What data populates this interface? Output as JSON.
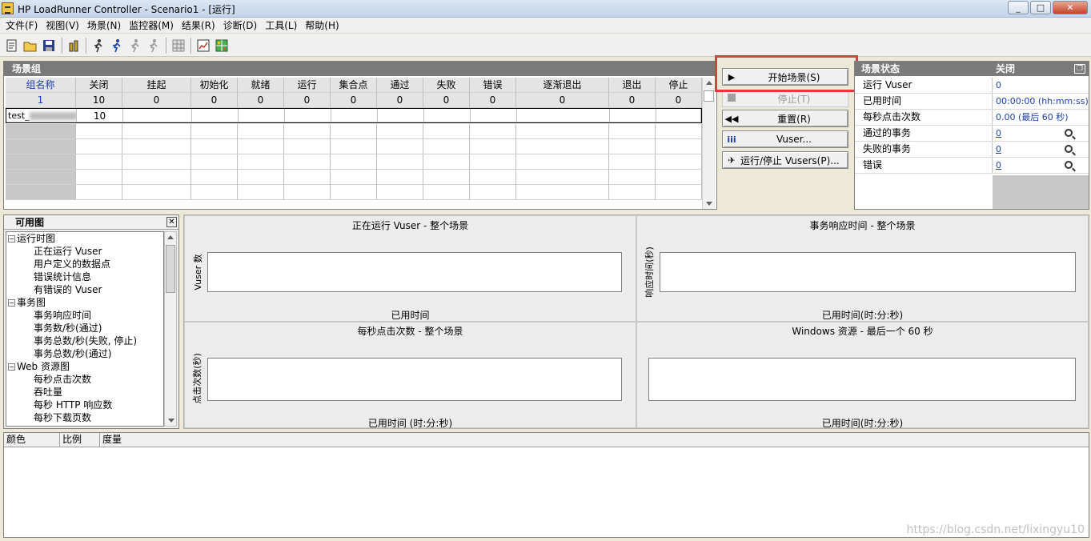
{
  "window": {
    "title": "HP LoadRunner Controller - Scenario1 - [运行]"
  },
  "menu": [
    "文件(F)",
    "视图(V)",
    "场景(N)",
    "监控器(M)",
    "结果(R)",
    "诊断(D)",
    "工具(L)",
    "帮助(H)"
  ],
  "scenario_group": {
    "title": "场景组",
    "columns": [
      "组名称",
      "关闭",
      "挂起",
      "初始化",
      "就绪",
      "运行",
      "集合点",
      "通过",
      "失败",
      "错误",
      "逐渐退出",
      "退出",
      "停止"
    ],
    "totals": [
      "1",
      "10",
      "0",
      "0",
      "0",
      "0",
      "0",
      "0",
      "0",
      "0",
      "0",
      "0",
      "0"
    ],
    "rows": [
      {
        "name": "test_",
        "off": "10"
      }
    ]
  },
  "controls": {
    "start": "开始场景(S)",
    "stop": "停止(T)",
    "reset": "重置(R)",
    "vusers": "Vuser...",
    "runstop": "运行/停止 Vusers(P)..."
  },
  "status": {
    "title": "场景状态",
    "state": "关闭",
    "rows": [
      {
        "label": "运行 Vuser",
        "value": "0"
      },
      {
        "label": "已用时间",
        "value": "00:00:00 (hh:mm:ss)"
      },
      {
        "label": "每秒点击次数",
        "value": "0.00 (最后 60 秒)"
      },
      {
        "label": "通过的事务",
        "value": "0"
      },
      {
        "label": "失败的事务",
        "value": "0"
      },
      {
        "label": "错误",
        "value": "0"
      }
    ]
  },
  "available_graphs": {
    "title": "可用图",
    "tree": [
      {
        "label": "运行时图",
        "level": 0
      },
      {
        "label": "正在运行 Vuser",
        "level": 1
      },
      {
        "label": "用户定义的数据点",
        "level": 1
      },
      {
        "label": "错误统计信息",
        "level": 1
      },
      {
        "label": "有错误的 Vuser",
        "level": 1
      },
      {
        "label": "事务图",
        "level": 0
      },
      {
        "label": "事务响应时间",
        "level": 1
      },
      {
        "label": "事务数/秒(通过)",
        "level": 1
      },
      {
        "label": "事务总数/秒(失败, 停止)",
        "level": 1
      },
      {
        "label": "事务总数/秒(通过)",
        "level": 1
      },
      {
        "label": "Web 资源图",
        "level": 0
      },
      {
        "label": "每秒点击次数",
        "level": 1
      },
      {
        "label": "吞吐量",
        "level": 1
      },
      {
        "label": "每秒 HTTP 响应数",
        "level": 1
      },
      {
        "label": "每秒下载页数",
        "level": 1
      }
    ]
  },
  "graphs": [
    {
      "title": "正在运行 Vuser - 整个场景",
      "ylabel": "Vuser 数",
      "xlabel": "已用时间"
    },
    {
      "title": "事务响应时间 - 整个场景",
      "ylabel": "响应时间(秒)",
      "xlabel": "已用时间(时:分:秒)"
    },
    {
      "title": "每秒点击次数 - 整个场景",
      "ylabel": "点击次数(秒)",
      "xlabel": "已用时间 (时:分:秒)"
    },
    {
      "title": "Windows 资源 - 最后一个 60 秒",
      "ylabel": "",
      "xlabel": "已用时间(时:分:秒)"
    }
  ],
  "legend": {
    "columns": [
      "颜色",
      "比例",
      "度量"
    ]
  },
  "watermark": "https://blog.csdn.net/lixingyu10"
}
